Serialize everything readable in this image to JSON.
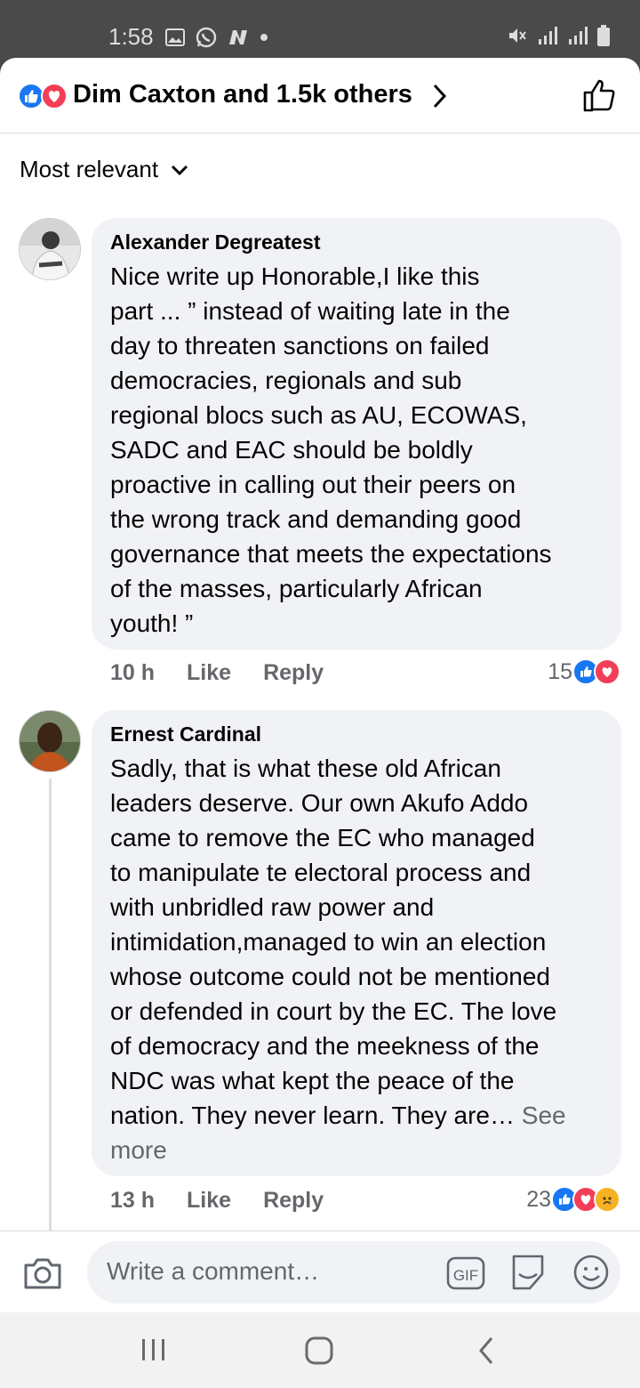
{
  "status_bar": {
    "time": "1:58"
  },
  "header": {
    "title": "Dim Caxton and 1.5k others"
  },
  "sort": {
    "label": "Most relevant"
  },
  "comments": [
    {
      "author": "Alexander Degreatest",
      "text": "Nice write up Honorable,I like this\npart ... ” instead of waiting late in the\nday to threaten sanctions on failed\ndemocracies, regionals and sub\nregional blocs such as AU, ECOWAS,\nSADC and EAC should be boldly\nproactive in calling out their peers on\nthe wrong track and demanding good\ngovernance that meets the expectations\nof the masses, particularly African\nyouth! ”",
      "time": "10 h",
      "like": "Like",
      "reply": "Reply",
      "reactions": "15"
    },
    {
      "author": "Ernest Cardinal",
      "text": "Sadly, that is what these old African\nleaders deserve. Our own Akufo Addo\ncame to remove the EC who managed\nto manipulate te electoral process and\nwith unbridled raw power and\nintimidation,managed to win an election\nwhose outcome could not be mentioned\nor defended in court by the EC. The love\nof democracy and the meekness of the\nNDC was what kept the peace of the\nnation. They never learn. They are…",
      "see_more_a": " See",
      "see_more_b": "more",
      "time": "13 h",
      "like": "Like",
      "reply": "Reply",
      "reactions": "23"
    }
  ],
  "composer": {
    "placeholder": "Write a comment…",
    "gif": "GIF"
  },
  "colors": {
    "like_blue": "#1877f2",
    "love_red": "#f33e58",
    "sad_yellow": "#f7b125",
    "meta_gray": "#65676b",
    "bubble_bg": "#f0f2f5"
  },
  "icons": [
    "photo-icon",
    "whatsapp-icon",
    "n-app-icon",
    "mute-icon",
    "signal-icon",
    "battery-icon",
    "like-reaction-icon",
    "love-reaction-icon",
    "sad-reaction-icon",
    "chevron-right-icon",
    "thumbs-up-outline-icon",
    "chevron-down-icon",
    "camera-icon",
    "gif-icon",
    "sticker-icon",
    "emoji-icon",
    "recents-icon",
    "home-icon",
    "back-icon"
  ]
}
